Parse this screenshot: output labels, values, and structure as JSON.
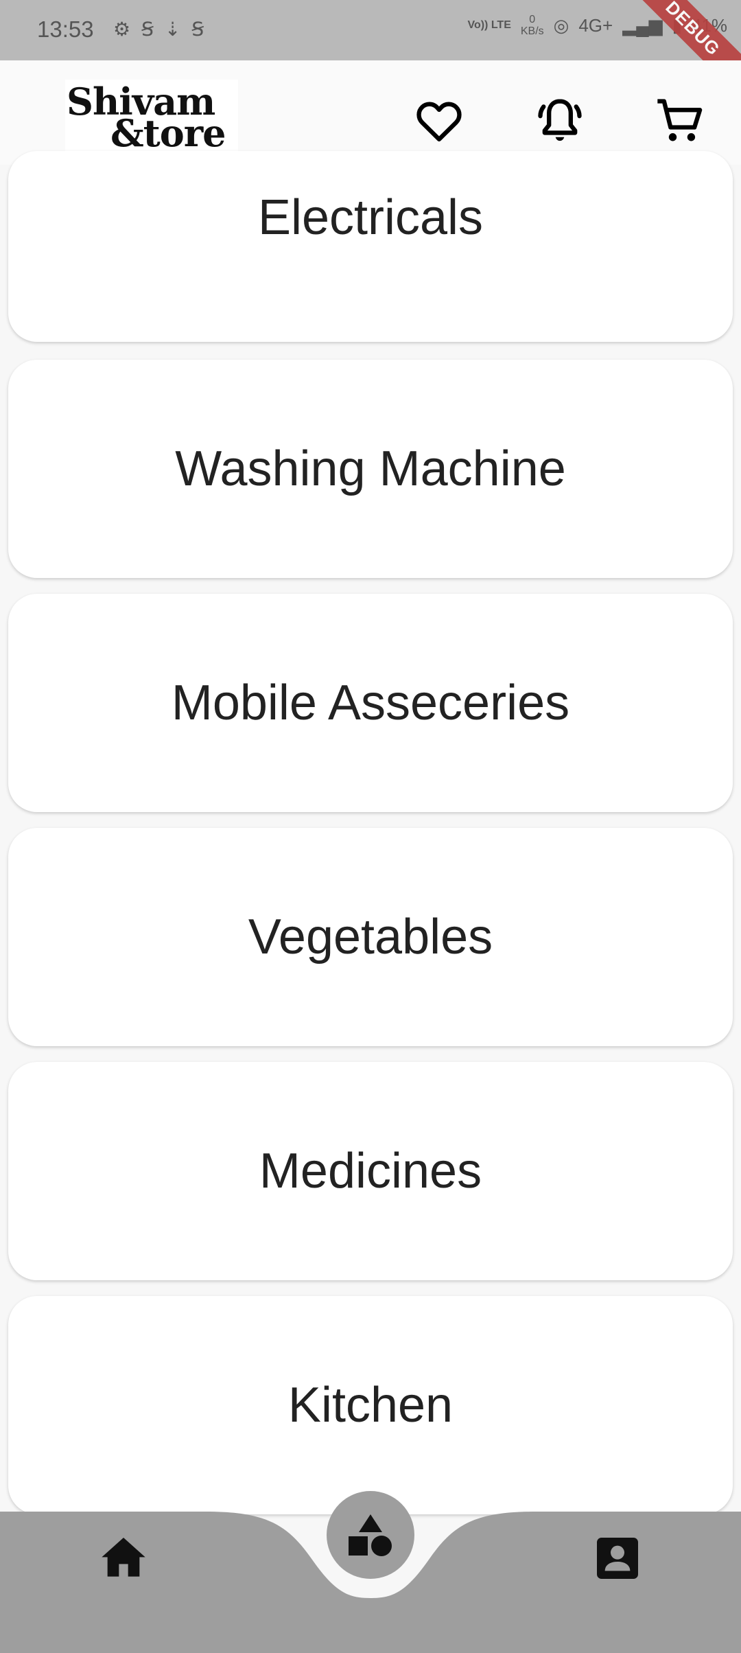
{
  "status_bar": {
    "time": "13:53",
    "left_icons": [
      "gear-icon",
      "sim-icon",
      "download-icon",
      "sim-icon"
    ],
    "volte": "Vo)) LTE",
    "net_speed": "0",
    "net_unit": "KB/s",
    "network": "4G+",
    "battery": "41%",
    "debug_label": "DEBUG"
  },
  "header": {
    "logo_line1": "Shivam",
    "logo_line2": "&tore",
    "actions": [
      "heart-icon",
      "bell-icon",
      "cart-icon"
    ]
  },
  "categories": [
    {
      "label": "Electricals"
    },
    {
      "label": "Washing Machine"
    },
    {
      "label": "Mobile Asseceries"
    },
    {
      "label": "Vegetables"
    },
    {
      "label": "Medicines"
    },
    {
      "label": "Kitchen"
    }
  ],
  "bottom_nav": {
    "items": [
      "home-icon",
      "categories-icon",
      "profile-icon"
    ],
    "selected": "categories-icon",
    "bar_color": "#9e9e9e"
  }
}
